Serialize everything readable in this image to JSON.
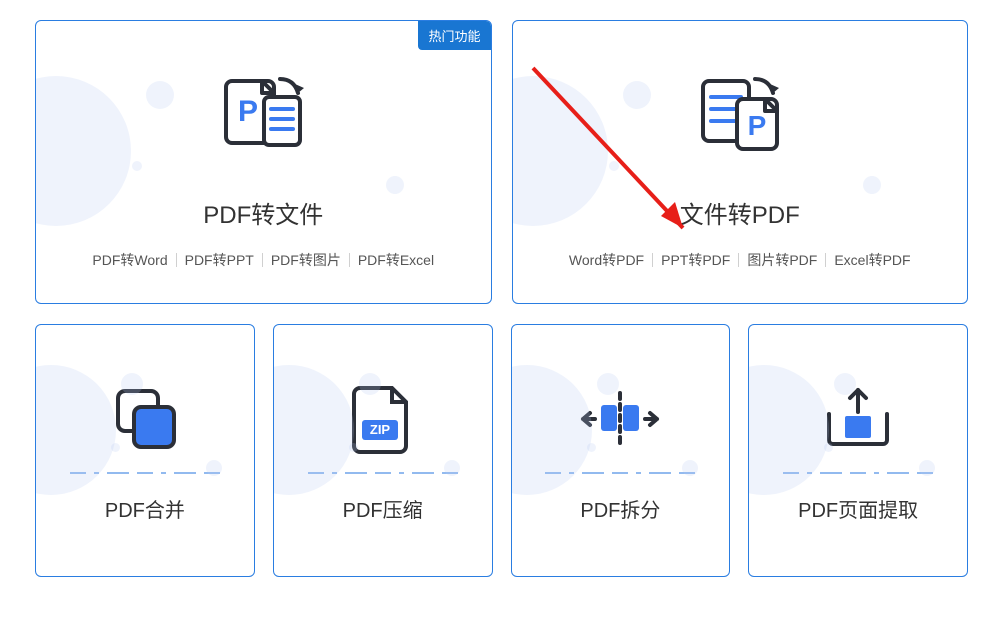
{
  "cards": {
    "pdf_to_file": {
      "badge": "热门功能",
      "title": "PDF转文件",
      "subs": [
        "PDF转Word",
        "PDF转PPT",
        "PDF转图片",
        "PDF转Excel"
      ]
    },
    "file_to_pdf": {
      "title": "文件转PDF",
      "subs": [
        "Word转PDF",
        "PPT转PDF",
        "图片转PDF",
        "Excel转PDF"
      ]
    },
    "merge": {
      "title": "PDF合并"
    },
    "compress": {
      "title": "PDF压缩",
      "zip_label": "ZIP"
    },
    "split": {
      "title": "PDF拆分"
    },
    "extract": {
      "title": "PDF页面提取"
    }
  }
}
